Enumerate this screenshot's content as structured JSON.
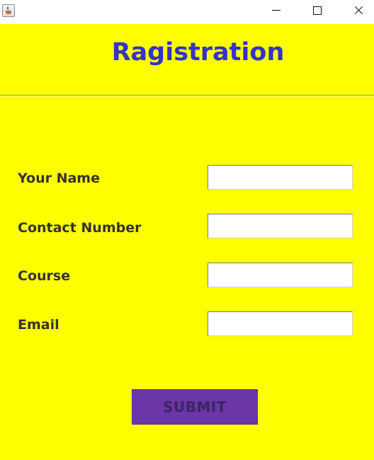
{
  "window": {
    "app_icon": "java-coffee-icon",
    "controls": {
      "minimize_icon": "minimize-icon",
      "maximize_icon": "maximize-icon",
      "close_icon": "close-icon"
    }
  },
  "form": {
    "title": "Ragistration",
    "fields": [
      {
        "label": "Your Name",
        "value": ""
      },
      {
        "label": "Contact Number",
        "value": ""
      },
      {
        "label": "Course",
        "value": ""
      },
      {
        "label": "Email",
        "value": ""
      }
    ],
    "submit_label": "SUBMIT"
  },
  "colors": {
    "background": "#ffff00",
    "title": "#3333cc",
    "label": "#333333",
    "submit_background": "#6a36a8",
    "submit_text": "#3a2560"
  }
}
